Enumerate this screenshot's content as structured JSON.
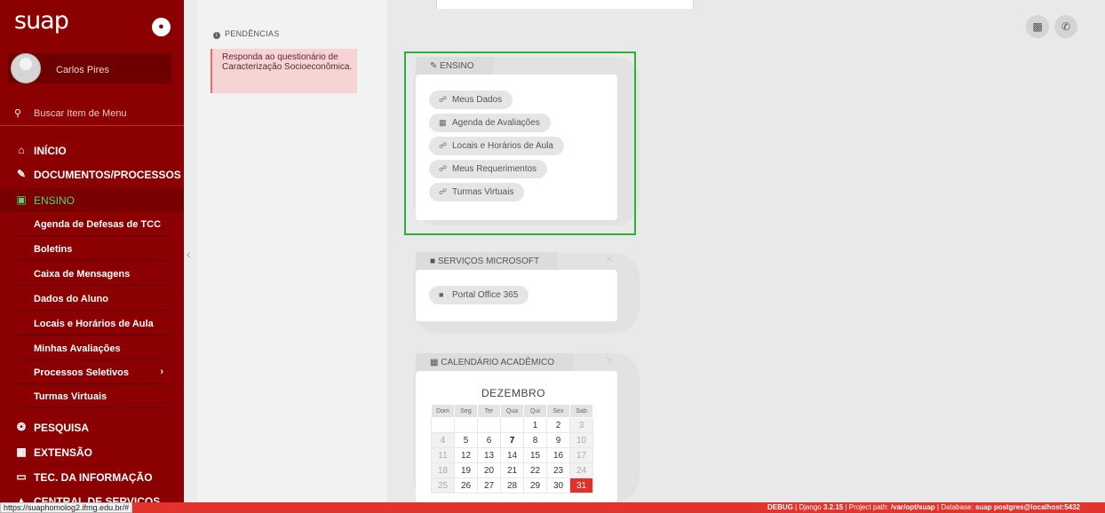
{
  "sidebar": {
    "logo": "suap",
    "user_name": "Carlos Pires",
    "search_placeholder": "Buscar Item de Menu",
    "menu": [
      {
        "label": "INÍCIO"
      },
      {
        "label": "DOCUMENTOS/PROCESSOS"
      },
      {
        "label": "ENSINO"
      },
      {
        "label": "PESQUISA"
      },
      {
        "label": "EXTENSÃO"
      },
      {
        "label": "TEC. DA INFORMAÇÃO"
      },
      {
        "label": "CENTRAL DE SERVIÇOS"
      }
    ],
    "ensino_items": [
      {
        "label": "Agenda de Defesas de TCC"
      },
      {
        "label": "Boletins"
      },
      {
        "label": "Caixa de Mensagens"
      },
      {
        "label": "Dados do Aluno"
      },
      {
        "label": "Locais e Horários de Aula"
      },
      {
        "label": "Minhas Avaliações"
      },
      {
        "label": "Processos Seletivos"
      },
      {
        "label": "Turmas Virtuais"
      }
    ]
  },
  "pendencias": {
    "title": "PENDÊNCIAS",
    "alert": "Responda ao questionário de Caracterização Socioeconômica."
  },
  "widgets": {
    "ensino": {
      "title": "ENSINO",
      "links": [
        "Meus Dados",
        "Agenda de Avaliações",
        "Locais e Horários de Aula",
        "Meus Requerimentos",
        "Turmas Virtuais"
      ]
    },
    "microsoft": {
      "title": "SERVIÇOS MICROSOFT",
      "links": [
        "Portal Office 365"
      ]
    },
    "calendario": {
      "title": "CALENDÁRIO ACADÊMICO",
      "month": "DEZEMBRO",
      "weekdays": [
        "Dom",
        "Seg",
        "Ter",
        "Qua",
        "Qui",
        "Sex",
        "Sab"
      ],
      "weeks": [
        [
          "",
          "",
          "",
          "",
          "1",
          "2",
          "3"
        ],
        [
          "4",
          "5",
          "6",
          "7",
          "8",
          "9",
          "10"
        ],
        [
          "11",
          "12",
          "13",
          "14",
          "15",
          "16",
          "17"
        ],
        [
          "18",
          "19",
          "20",
          "21",
          "22",
          "23",
          "24"
        ],
        [
          "25",
          "26",
          "27",
          "28",
          "29",
          "30",
          "31"
        ]
      ],
      "today": "7",
      "highlighted": "31"
    }
  },
  "status_url": "https://suaphomolog2.ifmg.edu.br/#",
  "footer": {
    "debug": "DEBUG",
    "django_label": "Django",
    "django_version": "3.2.15",
    "project_label": "Project path:",
    "project_path": "/var/opt/suap",
    "database_label": "Database:",
    "database": "suap postgres@localhost:5432"
  },
  "colors": {
    "sidebar": "#8b0000",
    "active_menu": "#4fd66e",
    "calendar_highlight": "#e0322a",
    "footer": "#e2332d",
    "highlight_border": "#27b23a"
  },
  "icons": {
    "bell": "bell-icon",
    "search": "search-icon",
    "home": "home-icon",
    "documents": "document-icon",
    "ensino": "ensino-icon",
    "pesquisa": "globe-icon",
    "extensao": "extension-icon",
    "ti": "computer-icon",
    "pdf": "pdf-icon",
    "phone": "phone-icon"
  }
}
